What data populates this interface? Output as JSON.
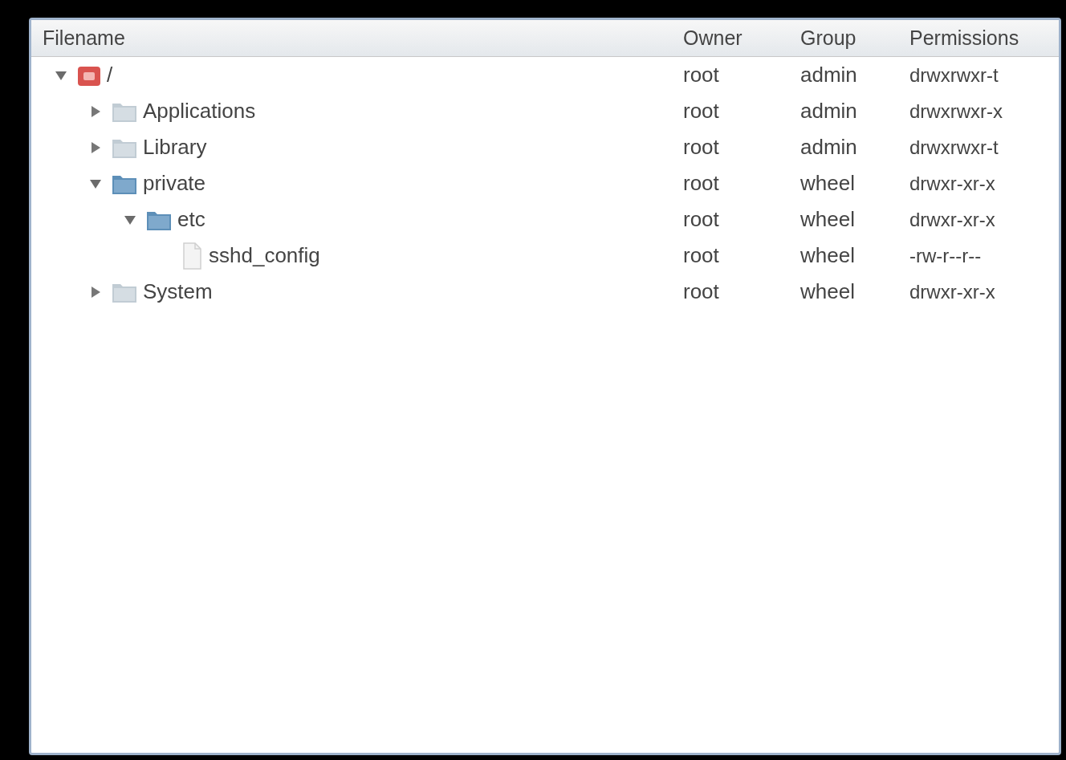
{
  "table": {
    "columns": [
      "Filename",
      "Owner",
      "Group",
      "Permissions"
    ],
    "rows": [
      {
        "kind": "volume",
        "name": "/",
        "owner": "root",
        "group": "admin",
        "permissions": "drwxrwxr-t",
        "expanded": true,
        "children": [
          {
            "kind": "folder",
            "name": "Applications",
            "owner": "root",
            "group": "admin",
            "permissions": "drwxrwxr-x",
            "expanded": false
          },
          {
            "kind": "folder",
            "name": "Library",
            "owner": "root",
            "group": "admin",
            "permissions": "drwxrwxr-t",
            "expanded": false
          },
          {
            "kind": "folder",
            "name": "private",
            "owner": "root",
            "group": "wheel",
            "permissions": "drwxr-xr-x",
            "expanded": true,
            "children": [
              {
                "kind": "folder",
                "name": "etc",
                "owner": "root",
                "group": "wheel",
                "permissions": "drwxr-xr-x",
                "expanded": true,
                "children": [
                  {
                    "kind": "file",
                    "name": "sshd_config",
                    "owner": "root",
                    "group": "wheel",
                    "permissions": "-rw-r--r--"
                  }
                ]
              }
            ]
          },
          {
            "kind": "folder",
            "name": "System",
            "owner": "root",
            "group": "wheel",
            "permissions": "drwxr-xr-x",
            "expanded": false
          }
        ]
      }
    ]
  }
}
